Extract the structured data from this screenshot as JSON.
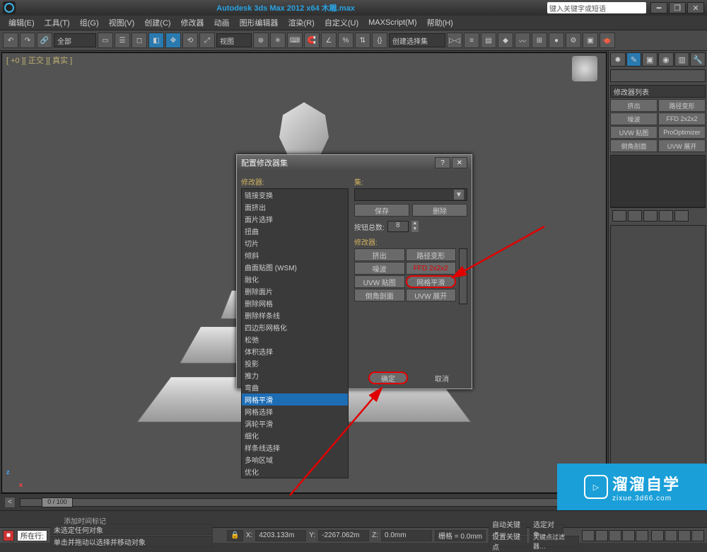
{
  "titlebar": {
    "app_title": "Autodesk 3ds Max  2012 x64    木雕.max",
    "search_placeholder": "键入关键字或短语"
  },
  "menu": [
    "编辑(E)",
    "工具(T)",
    "组(G)",
    "视图(V)",
    "创建(C)",
    "修改器",
    "动画",
    "图形编辑器",
    "渲染(R)",
    "自定义(U)",
    "MAXScript(M)",
    "帮助(H)"
  ],
  "toolbar": {
    "scope_label": "全部",
    "view_label": "视图",
    "select_set_label": "创建选择集"
  },
  "viewport": {
    "label": "[ +0 ][ 正交 ][ 真实 ]"
  },
  "cmdpanel": {
    "modifier_list_label": "修改器列表",
    "buttons": [
      "挤出",
      "路径变形",
      "噪波",
      "FFD 2x2x2",
      "UVW 贴图",
      "ProOptimizer",
      "倒角剖面",
      "UVW 展开"
    ]
  },
  "dialog": {
    "title": "配置修改器集",
    "left_label": "修改器:",
    "set_label": "集:",
    "save": "保存",
    "delete": "删除",
    "btn_total_label": "按钮总数:",
    "btn_total_value": "8",
    "right_label": "修改器:",
    "modifier_list": [
      "链接变换",
      "面挤出",
      "面片选择",
      "扭曲",
      "切片",
      "倾斜",
      "曲面贴图 (WSM)",
      "融化",
      "删除面片",
      "删除网格",
      "删除样条线",
      "四边形网格化",
      "松弛",
      "体积选择",
      "投影",
      "推力",
      "弯曲",
      "网格平滑",
      "网格选择",
      "涡轮平滑",
      "细化",
      "样条线选择",
      "多响区域",
      "优化"
    ],
    "selected_modifier": "网格平滑",
    "right_buttons": [
      "挤出",
      "路径变形",
      "噪波",
      "FFD 2x2x2",
      "UVW 贴图",
      "网格平滑",
      "倒角剖面",
      "UVW 展开"
    ],
    "ok": "确定",
    "cancel": "取消"
  },
  "timeslider": {
    "thumb": "0 / 100"
  },
  "status": {
    "none_selected": "未选定任何对象",
    "hint": "单击并拖动以选择并移动对象",
    "x": "4203.133m",
    "y": "-2267.062m",
    "z": "0.0mm",
    "grid": "栅格 = 0.0mm",
    "autokey": "自动关键点",
    "selected_obj_label": "选定对象",
    "setkey": "设置关键点",
    "keyfilter": "关键点过滤器…",
    "add_time_tag": "添加时间标记",
    "prompt_prefix": "所在行:"
  },
  "watermark": {
    "big": "溜溜自学",
    "small": "zixue.3d66.com"
  }
}
